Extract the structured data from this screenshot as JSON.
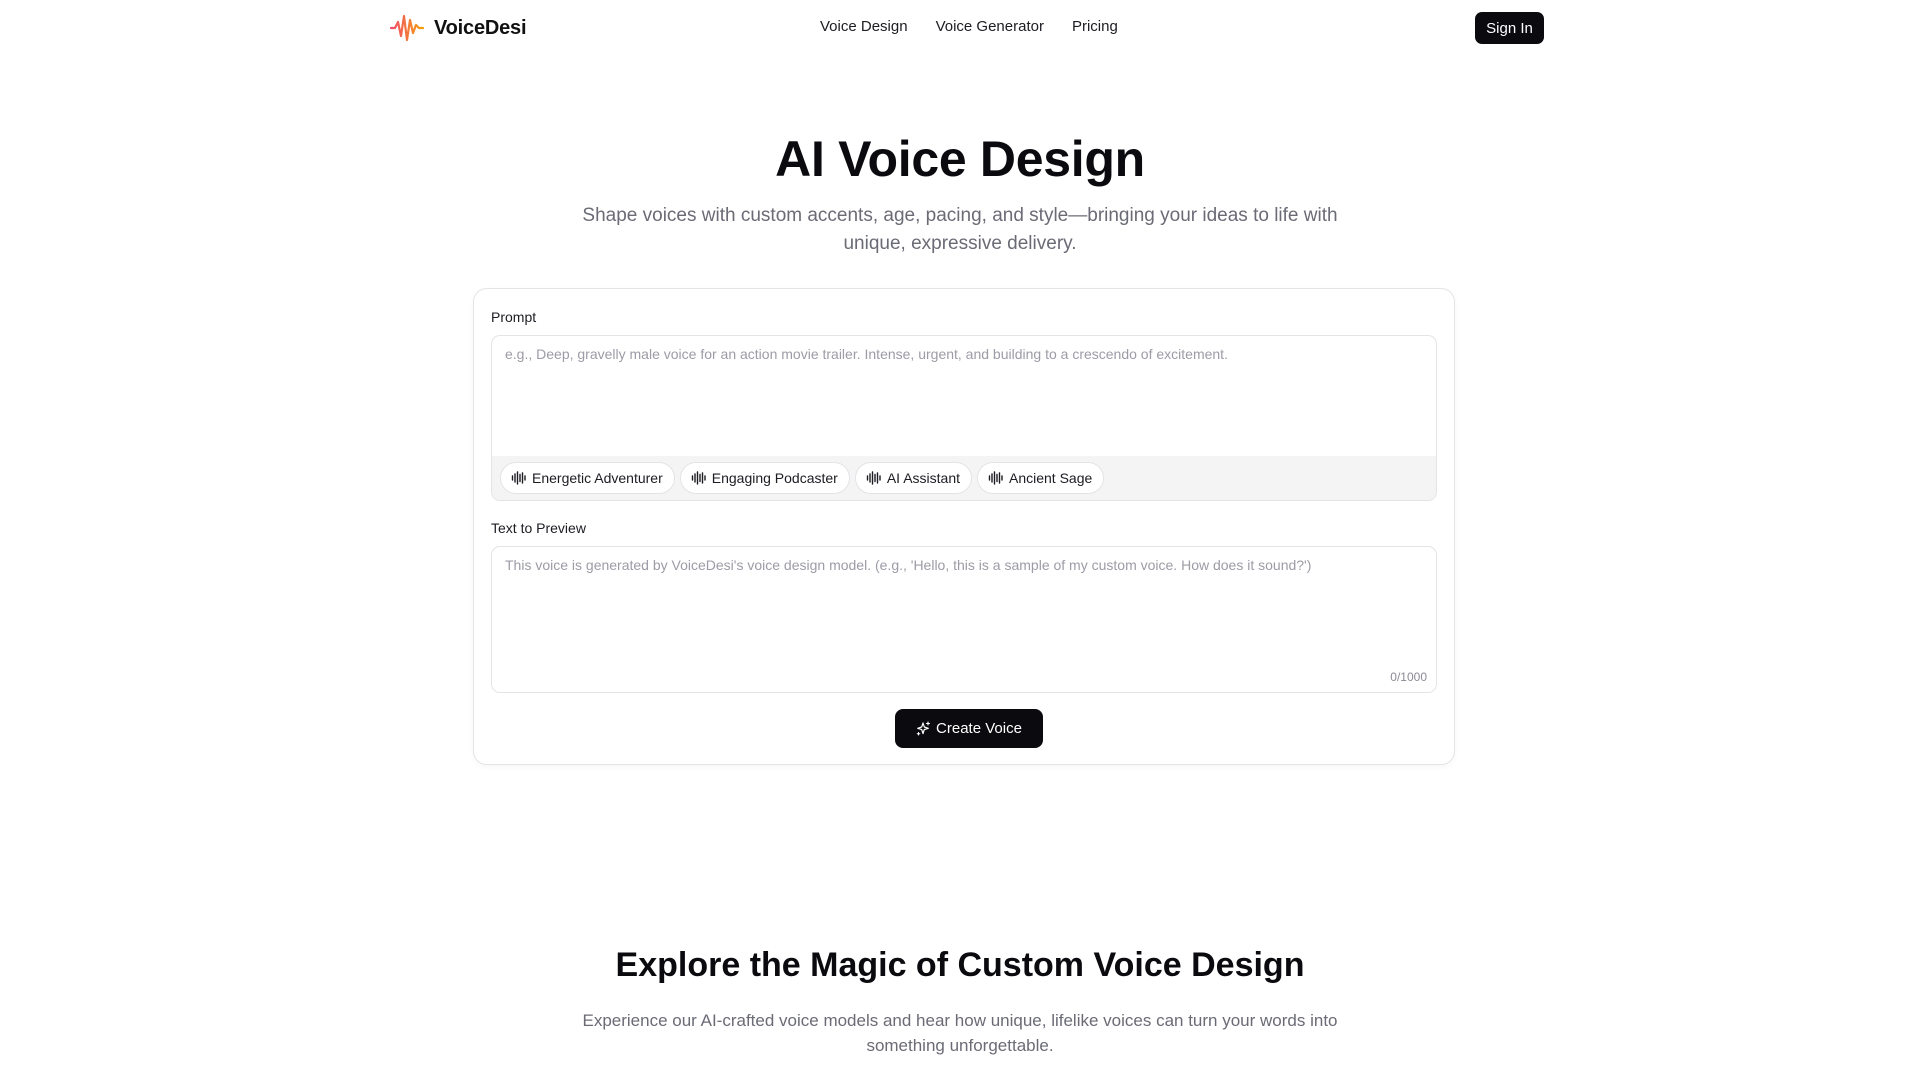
{
  "brand": {
    "name": "VoiceDesi",
    "logo_icon": "waveform-logo-icon",
    "logo_colors": [
      "#f04e6e",
      "#f59e0b"
    ]
  },
  "nav": {
    "items": [
      {
        "label": "Voice Design"
      },
      {
        "label": "Voice Generator"
      },
      {
        "label": "Pricing"
      }
    ],
    "signin_label": "Sign In"
  },
  "hero": {
    "title": "AI Voice Design",
    "subtitle": "Shape voices with custom accents, age, pacing, and style—bringing your ideas to life with unique, expressive delivery."
  },
  "form": {
    "prompt_label": "Prompt",
    "prompt_placeholder": "e.g., Deep, gravelly male voice for an action movie trailer. Intense, urgent, and building to a crescendo of excitement.",
    "prompt_value": "",
    "presets": [
      {
        "label": "Energetic Adventurer",
        "icon": "waveform-icon"
      },
      {
        "label": "Engaging Podcaster",
        "icon": "waveform-icon"
      },
      {
        "label": "AI Assistant",
        "icon": "waveform-icon"
      },
      {
        "label": "Ancient Sage",
        "icon": "waveform-icon"
      }
    ],
    "preview_label": "Text to Preview",
    "preview_placeholder": "This voice is generated by VoiceDesi's voice design model. (e.g., 'Hello, this is a sample of my custom voice. How does it sound?')",
    "preview_value": "",
    "char_count": "0/1000",
    "create_label": "Create Voice",
    "create_icon": "sparkle-icon"
  },
  "explore": {
    "title": "Explore the Magic of Custom Voice Design",
    "subtitle": "Experience our AI-crafted voice models and hear how unique, lifelike voices can turn your words into something unforgettable."
  },
  "colors": {
    "primary": "#0b0b0f",
    "muted_text": "#6b6b76",
    "border": "#e4e4e8",
    "chip_bar_bg": "#f4f4f5"
  }
}
